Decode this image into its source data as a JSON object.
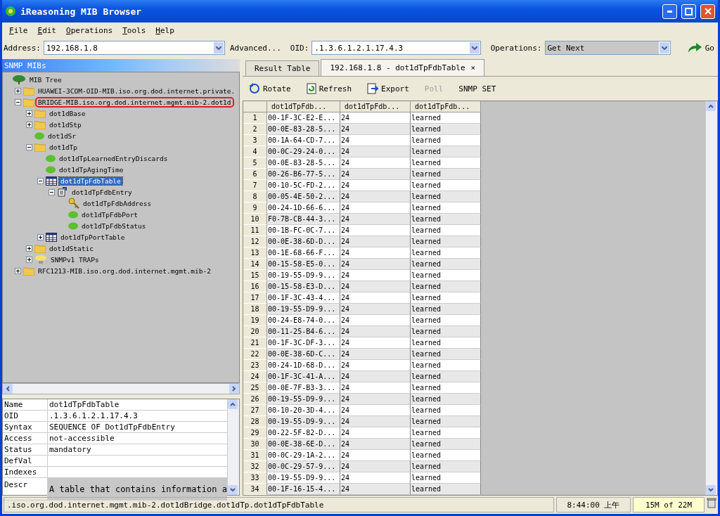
{
  "window": {
    "title": "iReasoning MIB Browser"
  },
  "menu": [
    "File",
    "Edit",
    "Operations",
    "Tools",
    "Help"
  ],
  "address_bar": {
    "address_label": "Address:",
    "address": "192.168.1.8",
    "advanced": "Advanced...",
    "oid_label": "OID:",
    "oid": ".1.3.6.1.2.1.17.4.3",
    "operations_label": "Operations:",
    "operation": "Get Next",
    "go": "Go"
  },
  "left_panel": {
    "title": "SNMP MIBs",
    "tree": [
      {
        "label": "MIB Tree",
        "kind": "tree",
        "selected": false,
        "outlined": false,
        "children": [
          {
            "label": "HUAWEI-3COM-OID-MIB.iso.org.dod.internet.private.",
            "kind": "folder",
            "expanded": false,
            "selected": false,
            "outlined": false
          },
          {
            "label": "BRIDGE-MIB.iso.org.dod.internet.mgmt.mib-2.dot1d",
            "kind": "folder",
            "expanded": true,
            "selected": false,
            "outlined": true,
            "children": [
              {
                "label": "dot1dBase",
                "kind": "folder",
                "expanded": false,
                "selected": false,
                "outlined": false
              },
              {
                "label": "dot1dStp",
                "kind": "folder",
                "expanded": false,
                "selected": false,
                "outlined": false
              },
              {
                "label": "dot1dSr",
                "kind": "leaf",
                "selected": false,
                "outlined": false
              },
              {
                "label": "dot1dTp",
                "kind": "folder",
                "expanded": true,
                "selected": false,
                "outlined": false,
                "children": [
                  {
                    "label": "dot1dTpLearnedEntryDiscards",
                    "kind": "leaf",
                    "selected": false,
                    "outlined": false
                  },
                  {
                    "label": "dot1dTpAgingTime",
                    "kind": "leaf",
                    "selected": false,
                    "outlined": false
                  },
                  {
                    "label": "dot1dTpFdbTable",
                    "kind": "table",
                    "expanded": true,
                    "selected": true,
                    "outlined": false,
                    "children": [
                      {
                        "label": "dot1dTpFdbEntry",
                        "kind": "entry",
                        "expanded": true,
                        "selected": false,
                        "outlined": false,
                        "children": [
                          {
                            "label": "dot1dTpFdbAddress",
                            "kind": "key",
                            "selected": false,
                            "outlined": false
                          },
                          {
                            "label": "dot1dTpFdbPort",
                            "kind": "leaf",
                            "selected": false,
                            "outlined": false
                          },
                          {
                            "label": "dot1dTpFdbStatus",
                            "kind": "leaf",
                            "selected": false,
                            "outlined": false
                          }
                        ]
                      }
                    ]
                  },
                  {
                    "label": "dot1dTpPortTable",
                    "kind": "table",
                    "expanded": false,
                    "selected": false,
                    "outlined": false
                  }
                ]
              },
              {
                "label": "dot1dStatic",
                "kind": "folder",
                "expanded": false,
                "selected": false,
                "outlined": false
              },
              {
                "label": "SNMPv1 TRAPs",
                "kind": "trap",
                "expanded": false,
                "selected": false,
                "outlined": false
              }
            ]
          },
          {
            "label": "RFC1213-MIB.iso.org.dod.internet.mgmt.mib-2",
            "kind": "folder",
            "expanded": false,
            "selected": false,
            "outlined": false
          }
        ]
      }
    ],
    "properties": [
      {
        "name": "Name",
        "value": "dot1dTpFdbTable"
      },
      {
        "name": "OID",
        "value": ".1.3.6.1.2.1.17.4.3"
      },
      {
        "name": "Syntax",
        "value": "SEQUENCE OF Dot1dTpFdbEntry"
      },
      {
        "name": "Access",
        "value": "not-accessible"
      },
      {
        "name": "Status",
        "value": "mandatory"
      },
      {
        "name": "DefVal"
      },
      {
        "name": "Indexes"
      },
      {
        "name": "Descr",
        "value": "A table that contains information a"
      }
    ]
  },
  "tabs": [
    {
      "label": "Result Table",
      "selected": false
    },
    {
      "label": "192.168.1.8 - dot1dTpFdbTable",
      "selected": true,
      "close": "×"
    }
  ],
  "toolbar": [
    {
      "label": "Rotate",
      "kind": "rotate",
      "disabled": false
    },
    {
      "label": "Refresh",
      "kind": "refresh",
      "disabled": false
    },
    {
      "label": "Export",
      "kind": "export",
      "disabled": false
    },
    {
      "label": "Poll",
      "kind": "text",
      "disabled": true
    },
    {
      "label": "SNMP SET",
      "kind": "text",
      "disabled": false
    }
  ],
  "table": {
    "columns": [
      "",
      "dot1dTpFdb...",
      "dot1dTpFdb...",
      "dot1dTpFdb..."
    ],
    "rows": [
      [
        "1",
        "00-1F-3C-E2-E...",
        "24",
        "learned"
      ],
      [
        "2",
        "00-0E-83-28-5...",
        "24",
        "learned"
      ],
      [
        "3",
        "00-1A-64-CD-7...",
        "24",
        "learned"
      ],
      [
        "4",
        "00-0C-29-24-0...",
        "24",
        "learned"
      ],
      [
        "5",
        "00-0E-83-28-5...",
        "24",
        "learned"
      ],
      [
        "6",
        "00-26-B6-77-5...",
        "24",
        "learned"
      ],
      [
        "7",
        "00-10-5C-FD-2...",
        "24",
        "learned"
      ],
      [
        "8",
        "00-05-4E-50-2...",
        "24",
        "learned"
      ],
      [
        "9",
        "00-24-1D-66-6...",
        "24",
        "learned"
      ],
      [
        "10",
        "F0-7B-CB-44-3...",
        "24",
        "learned"
      ],
      [
        "11",
        "00-1B-FC-0C-7...",
        "24",
        "learned"
      ],
      [
        "12",
        "00-0E-38-6D-D...",
        "24",
        "learned"
      ],
      [
        "13",
        "00-1E-68-66-F...",
        "24",
        "learned"
      ],
      [
        "14",
        "00-15-58-E5-0...",
        "24",
        "learned"
      ],
      [
        "15",
        "00-19-55-D9-9...",
        "24",
        "learned"
      ],
      [
        "16",
        "00-15-58-E3-D...",
        "24",
        "learned"
      ],
      [
        "17",
        "00-1F-3C-43-4...",
        "24",
        "learned"
      ],
      [
        "18",
        "00-19-55-D9-9...",
        "24",
        "learned"
      ],
      [
        "19",
        "00-24-E8-74-0...",
        "24",
        "learned"
      ],
      [
        "20",
        "00-11-25-B4-6...",
        "24",
        "learned"
      ],
      [
        "21",
        "00-1F-3C-DF-3...",
        "24",
        "learned"
      ],
      [
        "22",
        "00-0E-38-6D-C...",
        "24",
        "learned"
      ],
      [
        "23",
        "00-24-1D-68-D...",
        "24",
        "learned"
      ],
      [
        "24",
        "00-1F-3C-41-A...",
        "24",
        "learned"
      ],
      [
        "25",
        "00-0E-7F-B3-3...",
        "24",
        "learned"
      ],
      [
        "26",
        "00-19-55-D9-9...",
        "24",
        "learned"
      ],
      [
        "27",
        "00-10-20-3D-4...",
        "24",
        "learned"
      ],
      [
        "28",
        "00-19-55-D9-9...",
        "24",
        "learned"
      ],
      [
        "29",
        "00-22-5F-82-D...",
        "24",
        "learned"
      ],
      [
        "30",
        "00-0E-38-6E-D...",
        "24",
        "learned"
      ],
      [
        "31",
        "00-0C-29-1A-2...",
        "24",
        "learned"
      ],
      [
        "32",
        "00-0C-29-57-9...",
        "24",
        "learned"
      ],
      [
        "33",
        "00-19-55-D9-9...",
        "24",
        "learned"
      ],
      [
        "34",
        "00-1F-16-15-4...",
        "24",
        "learned"
      ]
    ]
  },
  "status_bar": {
    "path": ".iso.org.dod.internet.mgmt.mib-2.dot1dBridge.dot1dTp.dot1dTpFdbTable",
    "time": "8:44:00 上午",
    "memory": "15M of 22M"
  }
}
